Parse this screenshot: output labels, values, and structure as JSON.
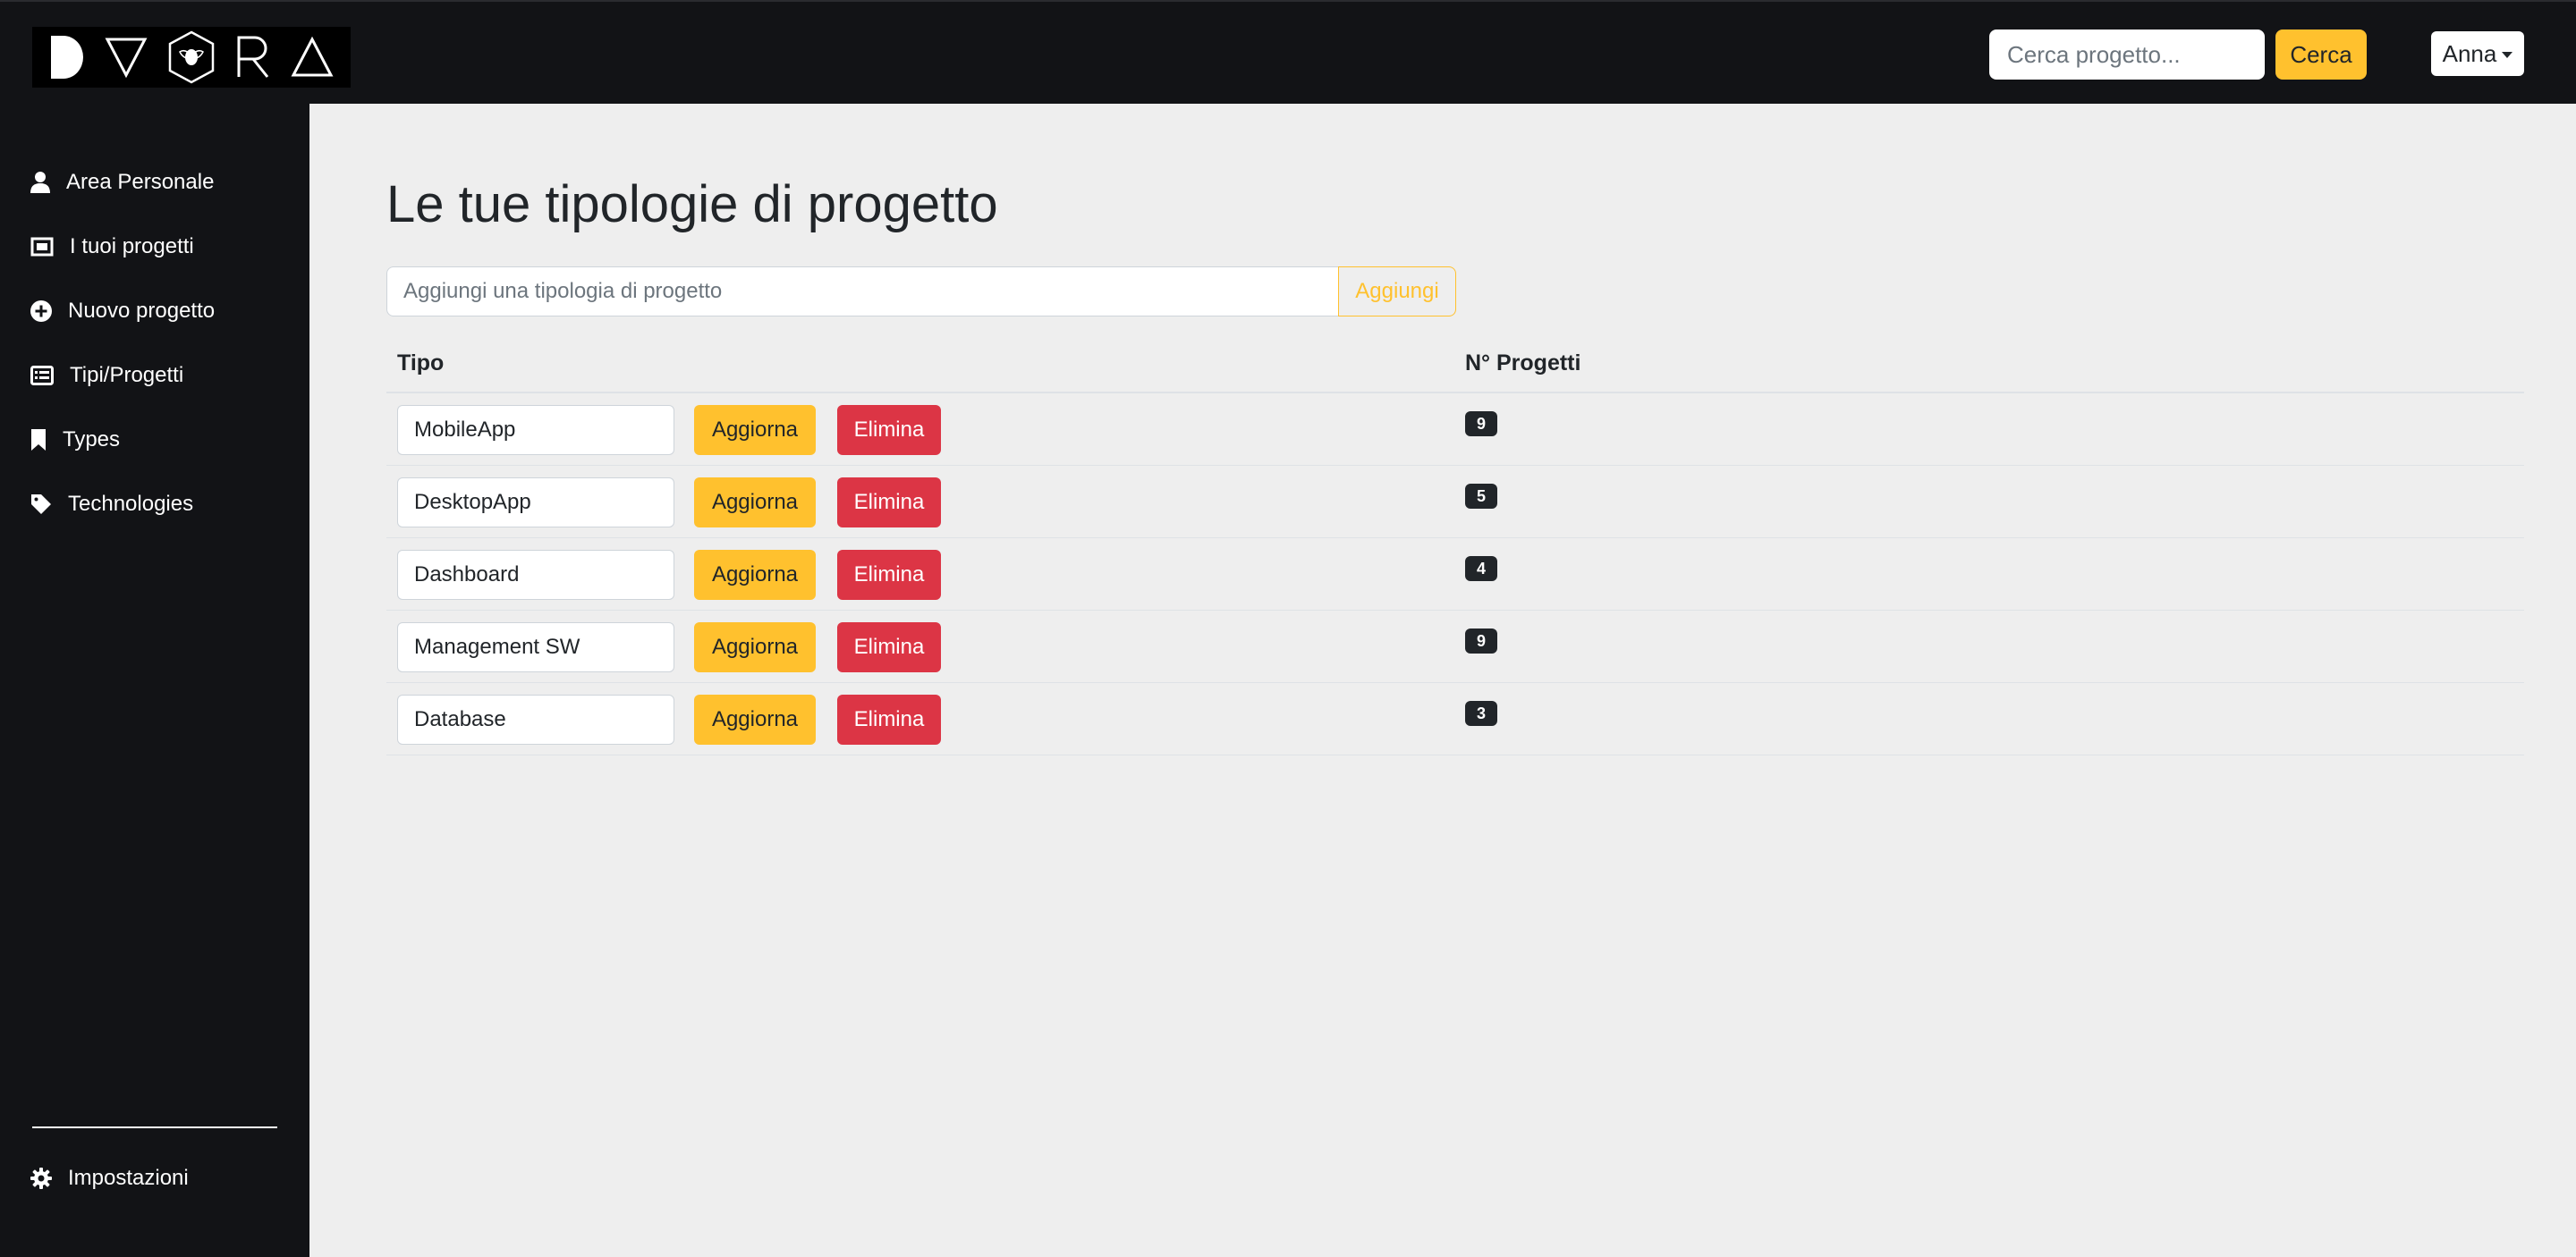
{
  "header": {
    "logo_letters": [
      "D",
      "V",
      "O",
      "R",
      "A"
    ],
    "search": {
      "placeholder": "Cerca progetto...",
      "value": ""
    },
    "search_button": "Cerca",
    "user_menu": {
      "label": "Anna",
      "icon": "caret-down-icon"
    }
  },
  "sidebar": {
    "items": [
      {
        "label": "Area Personale",
        "icon": "user-icon"
      },
      {
        "label": "I tuoi progetti",
        "icon": "gallery-icon"
      },
      {
        "label": "Nuovo progetto",
        "icon": "plus-circle-icon"
      },
      {
        "label": "Tipi/Progetti",
        "icon": "list-icon"
      },
      {
        "label": "Types",
        "icon": "bookmark-icon"
      },
      {
        "label": "Technologies",
        "icon": "tag-icon"
      }
    ],
    "footer_item": {
      "label": "Impostazioni",
      "icon": "gear-icon"
    }
  },
  "main": {
    "title": "Le tue tipologie di progetto",
    "add_form": {
      "placeholder": "Aggiungi una tipologia di progetto",
      "value": "",
      "button": "Aggiungi"
    },
    "table": {
      "headers": {
        "type": "Tipo",
        "count": "N° Progetti"
      },
      "rows": [
        {
          "name": "MobileApp",
          "update": "Aggiorna",
          "delete": "Elimina",
          "count": "9"
        },
        {
          "name": "DesktopApp",
          "update": "Aggiorna",
          "delete": "Elimina",
          "count": "5"
        },
        {
          "name": "Dashboard",
          "update": "Aggiorna",
          "delete": "Elimina",
          "count": "4"
        },
        {
          "name": "Management SW",
          "update": "Aggiorna",
          "delete": "Elimina",
          "count": "9"
        },
        {
          "name": "Database",
          "update": "Aggiorna",
          "delete": "Elimina",
          "count": "3"
        }
      ]
    }
  },
  "colors": {
    "dark": "#121316",
    "accent": "#ffc12e",
    "danger": "#dc3545",
    "background": "#eeeeee"
  }
}
